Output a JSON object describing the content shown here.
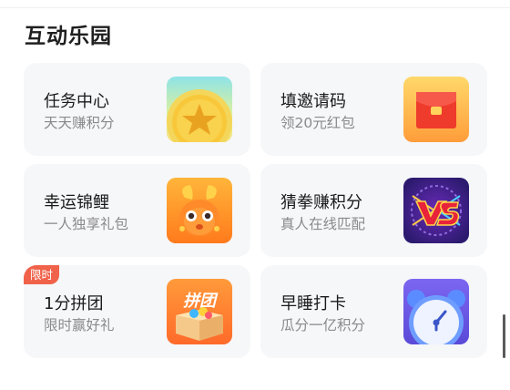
{
  "section": {
    "title": "互动乐园"
  },
  "cards": [
    {
      "title": "任务中心",
      "subtitle": "天天赚积分",
      "icon": "star-coin-icon"
    },
    {
      "title": "填邀请码",
      "subtitle": "领20元红包",
      "icon": "red-envelope-icon"
    },
    {
      "title": "幸运锦鲤",
      "subtitle": "一人独享礼包",
      "icon": "koi-fish-icon"
    },
    {
      "title": "猜拳赚积分",
      "subtitle": "真人在线匹配",
      "icon": "vs-icon"
    },
    {
      "title": "1分拼团",
      "subtitle": "限时赢好礼",
      "icon": "group-buy-box-icon",
      "badge": "限时",
      "art_text": "拼团"
    },
    {
      "title": "早睡打卡",
      "subtitle": "瓜分一亿积分",
      "icon": "alarm-clock-icon"
    }
  ],
  "colors": {
    "badge": "#f0634a",
    "card_bg": "#f6f7f9"
  }
}
